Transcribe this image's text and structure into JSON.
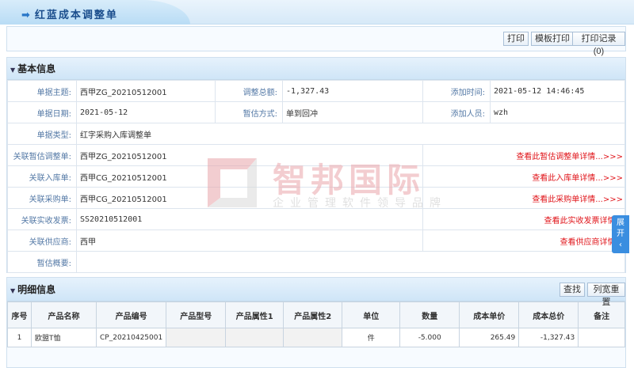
{
  "header": {
    "title": "红蓝成本调整单"
  },
  "toolbar": {
    "print": "打印",
    "template_print": "模板打印",
    "print_log": "打印记录(0)"
  },
  "basic": {
    "title": "基本信息",
    "subject_label": "单据主题:",
    "subject": "西甲ZG_20210512001",
    "total_label": "调整总额:",
    "total": "-1,327.43",
    "add_time_label": "添加时间:",
    "add_time": "2021-05-12 14:46:45",
    "date_label": "单据日期:",
    "date": "2021-05-12",
    "method_label": "暂估方式:",
    "method": "单到回冲",
    "adder_label": "添加人员:",
    "adder": "wzh",
    "type_label": "单据类型:",
    "type": "红字采购入库调整单",
    "links": [
      {
        "label": "关联暂估调整单:",
        "value": "西甲ZG_20210512001",
        "link": "查看此暂估调整单详情...>>>"
      },
      {
        "label": "关联入库单:",
        "value": "西甲CG_20210512001",
        "link": "查看此入库单详情...>>>"
      },
      {
        "label": "关联采购单:",
        "value": "西甲CG_20210512001",
        "link": "查看此采购单详情...>>>"
      },
      {
        "label": "关联实收发票:",
        "value": "SS20210512001",
        "link": "查看此实收发票详情..."
      },
      {
        "label": "关联供应商:",
        "value": "西甲",
        "link": "查看供应商详情..."
      }
    ],
    "summary_label": "暂估概要:",
    "summary": ""
  },
  "watermark": {
    "name": "智邦国际",
    "slogan": "企业管理软件领导品牌"
  },
  "side_tab": {
    "label1": "展",
    "label2": "开",
    "icon": "chevron-left-icon"
  },
  "detail": {
    "title": "明细信息",
    "find": "查找",
    "reset": "列宽重置",
    "columns": [
      "序号",
      "产品名称",
      "产品编号",
      "产品型号",
      "产品属性1",
      "产品属性2",
      "单位",
      "数量",
      "成本单价",
      "成本总价",
      "备注"
    ],
    "rows": [
      [
        "1",
        "欧盟T恤",
        "CP_20210425001",
        "",
        "",
        "",
        "件",
        "-5.000",
        "265.49",
        "-1,327.43",
        ""
      ]
    ]
  },
  "colors": {
    "link": "#e0141a",
    "label": "#5479a6",
    "accent": "#3a8ee0"
  }
}
